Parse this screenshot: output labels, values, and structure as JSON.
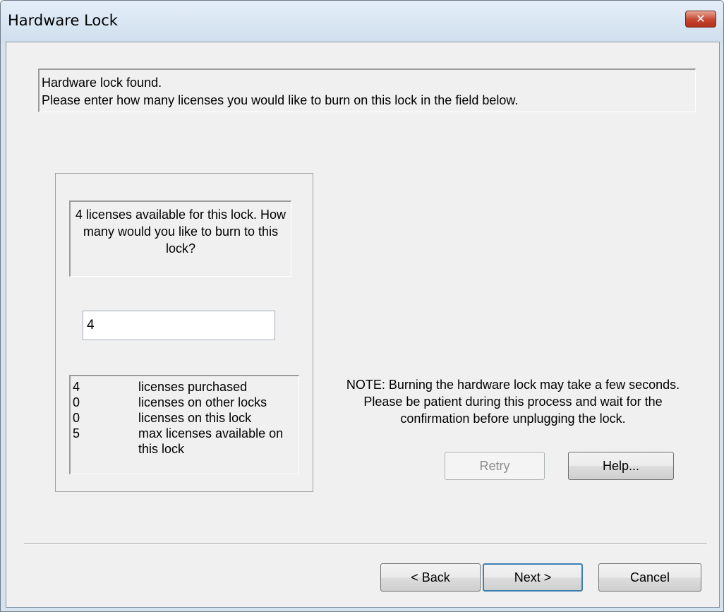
{
  "window": {
    "title": "Hardware Lock",
    "close_label": "✕"
  },
  "message": {
    "line1": "Hardware lock found.",
    "line2": "Please enter how many licenses you would like to burn on this lock in the field below."
  },
  "question": {
    "text": "4 licenses available for this lock. How many would you like to burn to this lock?"
  },
  "license_input": {
    "value": "4"
  },
  "license_summary": [
    {
      "count": "4",
      "label": "licenses purchased"
    },
    {
      "count": "0",
      "label": "licenses on other locks"
    },
    {
      "count": "0",
      "label": "licenses on this lock"
    },
    {
      "count": "5",
      "label": "max licenses available on this lock"
    }
  ],
  "note": {
    "text": "NOTE: Burning the hardware lock may take a few seconds. Please be patient during this process and wait for the confirmation before unplugging the lock."
  },
  "buttons": {
    "retry": "Retry",
    "help": "Help...",
    "back": "< Back",
    "next": "Next >",
    "cancel": "Cancel"
  }
}
